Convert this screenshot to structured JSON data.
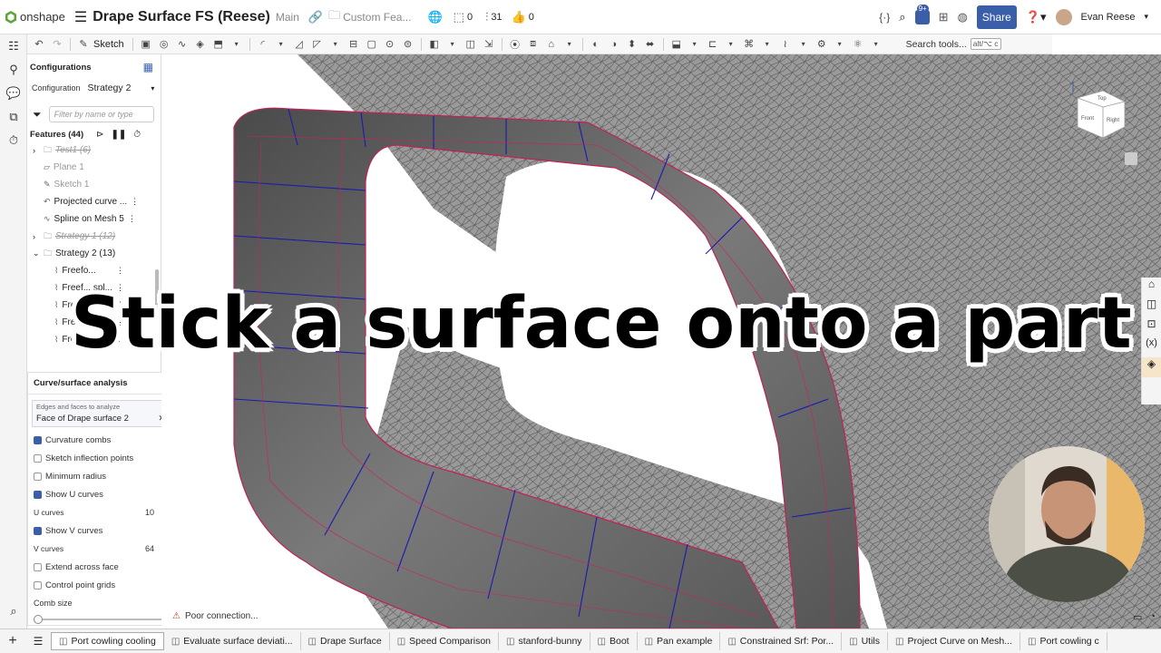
{
  "app": {
    "logo_text": "onshape",
    "doc_title": "Drape Surface FS (Reese)",
    "branch": "Main",
    "folder": "Custom Fea...",
    "count_a": "0",
    "count_b": "31",
    "count_c": "0",
    "share_label": "Share",
    "user_name": "Evan Reese",
    "notif_badge": "9+"
  },
  "toolbar": {
    "sketch_label": "Sketch",
    "search_placeholder": "Search tools...",
    "search_shortcut": "alt/⌥ c"
  },
  "panel": {
    "configurations_title": "Configurations",
    "config_label": "Configuration",
    "config_value": "Strategy 2",
    "filter_placeholder": "Filter by name or type",
    "features_title": "Features (44)",
    "features": [
      {
        "label": "Test1 (6)",
        "style": "strike",
        "kind": "folder",
        "expand": "›"
      },
      {
        "label": "Plane 1",
        "style": "greyed",
        "kind": "plane"
      },
      {
        "label": "Sketch 1",
        "style": "greyed",
        "kind": "sketch"
      },
      {
        "label": "Projected curve ...",
        "style": "normal",
        "kind": "curve"
      },
      {
        "label": "Spline on Mesh 5",
        "style": "normal",
        "kind": "spline"
      },
      {
        "label": "Strategy 1 (12)",
        "style": "strike",
        "kind": "folder",
        "expand": "›"
      },
      {
        "label": "Strategy 2 (13)",
        "style": "normal",
        "kind": "folder",
        "expand": "⌄"
      },
      {
        "label": "Freefo...",
        "style": "normal",
        "kind": "surface"
      },
      {
        "label": "Freef... spl...",
        "style": "normal",
        "kind": "surface"
      },
      {
        "label": "Freefo...",
        "style": "normal",
        "kind": "surface"
      },
      {
        "label": "Free...",
        "style": "normal",
        "kind": "surface"
      },
      {
        "label": "Freeform spl...",
        "style": "normal",
        "kind": "surface"
      }
    ]
  },
  "analysis": {
    "title": "Curve/surface analysis",
    "edges_label": "Edges and faces to analyze",
    "edges_value": "Face of Drape surface 2",
    "options": [
      {
        "label": "Curvature combs",
        "checked": true
      },
      {
        "label": "Sketch inflection points",
        "checked": false
      },
      {
        "label": "Minimum radius",
        "checked": false
      },
      {
        "label": "Show U curves",
        "checked": true
      }
    ],
    "u_curves_label": "U curves",
    "u_curves_value": "10",
    "show_v_label": "Show V curves",
    "v_curves_label": "V curves",
    "v_curves_value": "64",
    "options2": [
      {
        "label": "Extend across face",
        "checked": false
      },
      {
        "label": "Control point grids",
        "checked": false
      }
    ],
    "comb_size_label": "Comb size"
  },
  "viewport": {
    "caption": "Stick a surface onto a part",
    "connection_status": "Poor connection...",
    "viewcube_front": "Front",
    "viewcube_right": "Right",
    "viewcube_top": "Top",
    "colors": {
      "mesh": "#8a8a8a",
      "surface": "#6e6e6e",
      "u_lines": "#1a1ab0",
      "v_lines": "#d0205a"
    }
  },
  "tabs": [
    {
      "label": "Port cowling cooling",
      "active": true
    },
    {
      "label": "Evaluate surface deviati...",
      "active": false
    },
    {
      "label": "Drape Surface",
      "active": false
    },
    {
      "label": "Speed Comparison",
      "active": false
    },
    {
      "label": "stanford-bunny",
      "active": false
    },
    {
      "label": "Boot",
      "active": false
    },
    {
      "label": "Pan example",
      "active": false
    },
    {
      "label": "Constrained Srf: Por...",
      "active": false
    },
    {
      "label": "Utils",
      "active": false
    },
    {
      "label": "Project Curve on Mesh...",
      "active": false
    },
    {
      "label": "Port cowling c",
      "active": false
    }
  ]
}
